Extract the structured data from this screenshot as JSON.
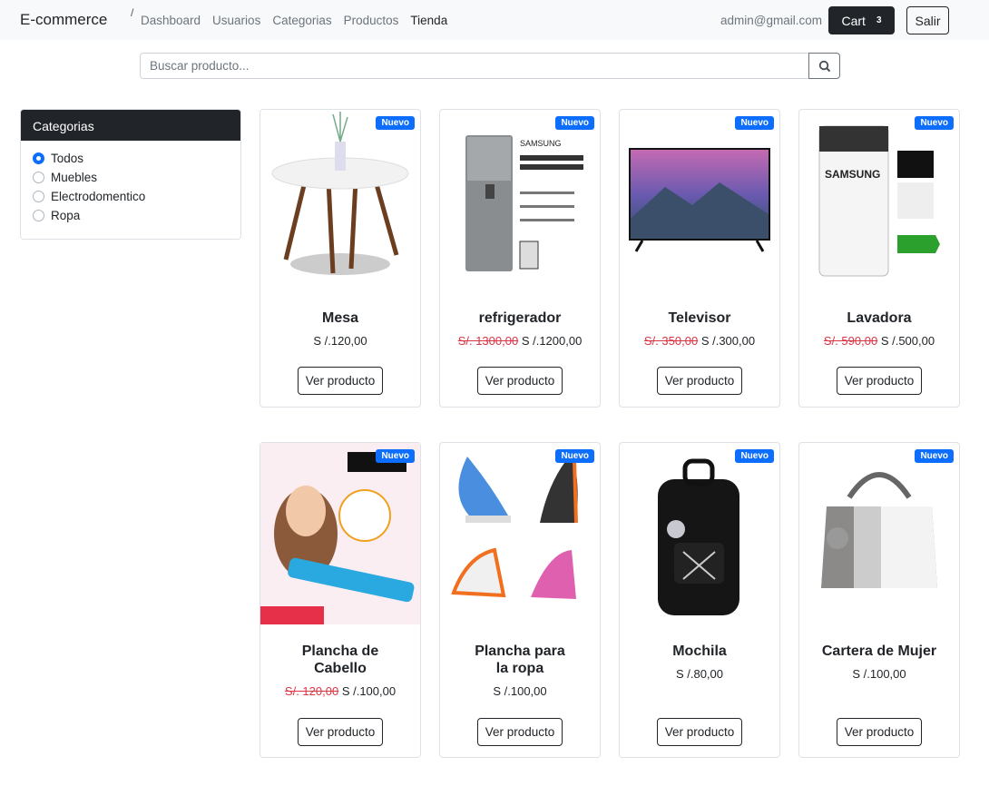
{
  "nav": {
    "brand": "E-commerce",
    "separator": "/",
    "links": [
      "Dashboard",
      "Usuarios",
      "Categorias",
      "Productos",
      "Tienda"
    ],
    "email": "admin@gmail.com",
    "cart_label": "Cart",
    "cart_count": "3",
    "logout": "Salir"
  },
  "search": {
    "placeholder": "Buscar producto...",
    "value": ""
  },
  "categories": {
    "title": "Categorias",
    "options": [
      "Todos",
      "Muebles",
      "Electrodomentico",
      "Ropa"
    ],
    "selected": "Todos"
  },
  "products": [
    {
      "name": "Mesa",
      "old_price": "",
      "price": "S /.120,00",
      "badge": "Nuevo",
      "button": "Ver producto"
    },
    {
      "name": "refrigerador",
      "old_price": "S/. 1300,00",
      "price": "S /.1200,00",
      "badge": "Nuevo",
      "button": "Ver producto"
    },
    {
      "name": "Televisor",
      "old_price": "S/. 350,00",
      "price": "S /.300,00",
      "badge": "Nuevo",
      "button": "Ver producto"
    },
    {
      "name": "Lavadora",
      "old_price": "S/. 590,00",
      "price": "S /.500,00",
      "badge": "Nuevo",
      "button": "Ver producto"
    },
    {
      "name": "Plancha de Cabello",
      "old_price": "S/. 120,00",
      "price": "S /.100,00",
      "badge": "Nuevo",
      "button": "Ver producto"
    },
    {
      "name": "Plancha para la ropa",
      "old_price": "",
      "price": "S /.100,00",
      "badge": "Nuevo",
      "button": "Ver producto"
    },
    {
      "name": "Mochila",
      "old_price": "",
      "price": "S /.80,00",
      "badge": "Nuevo",
      "button": "Ver producto"
    },
    {
      "name": "Cartera de Mujer",
      "old_price": "",
      "price": "S /.100,00",
      "badge": "Nuevo",
      "button": "Ver producto"
    }
  ],
  "colors": {
    "primary": "#0d6efd",
    "dark": "#212529",
    "danger": "#dc3545"
  }
}
